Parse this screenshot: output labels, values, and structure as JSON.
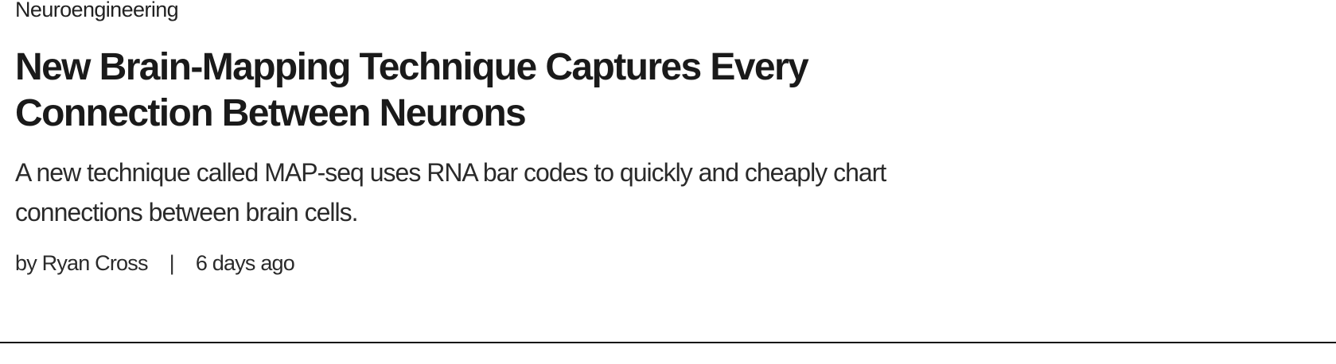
{
  "article": {
    "category": "Neuroengineering",
    "title": "New Brain-Mapping Technique Captures Every Connection Between Neurons",
    "dek": "A new technique called MAP-seq uses RNA bar codes to quickly and cheaply chart connections between brain cells.",
    "byline": {
      "author": "by Ryan Cross",
      "separator": "|",
      "date": "6 days ago"
    }
  },
  "colors": {
    "text": "#1c1c1c",
    "divider": "#111111",
    "background": "#ffffff"
  }
}
